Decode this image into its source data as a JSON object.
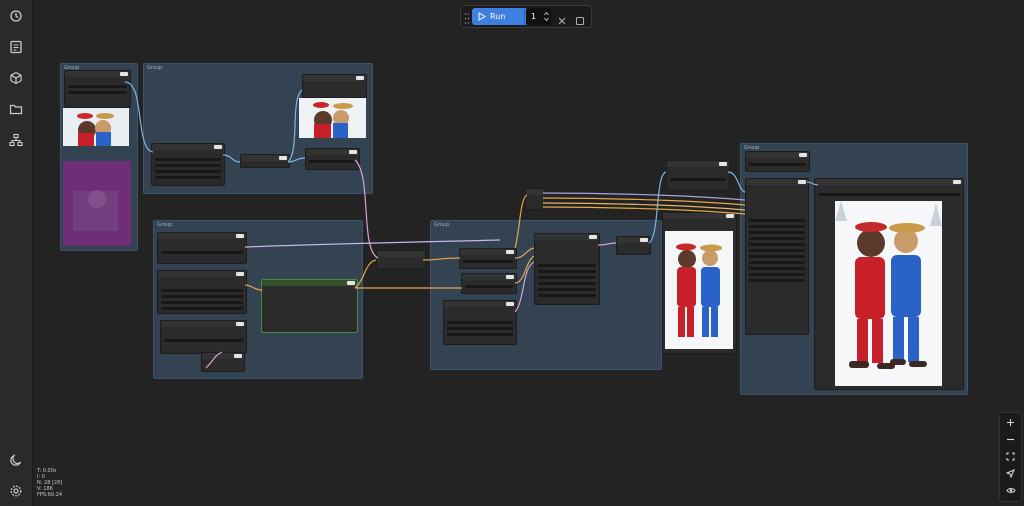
{
  "toolbar": {
    "run_label": "Run",
    "queue_count": "1"
  },
  "groups": {
    "g1": "Group",
    "g2": "Group",
    "g3": "Group",
    "g4": "Group",
    "g5": "Group"
  },
  "stats": {
    "line1": "T: 0.00s",
    "line2": "I: 0",
    "line3": "N: 28 [28]",
    "line4": "V: 186",
    "line5": "FPS:60.24"
  },
  "icons": {
    "history": "history-icon",
    "queue": "queue-icon",
    "nodes": "cube-icon",
    "files": "folder-icon",
    "models": "workflow-icon",
    "theme": "moon-icon",
    "settings": "gear-icon",
    "zoom_in": "plus-icon",
    "zoom_out": "minus-icon",
    "fit": "fit-view-icon",
    "select": "cursor-icon",
    "toggle": "eye-icon"
  },
  "colors": {
    "run_button": "#3f7fe0",
    "group_bg": "#334352",
    "wire_blue": "#7fb4e6",
    "wire_orange": "#e6a64a",
    "wire_pink": "#d9a2d6",
    "node_highlight": "#4a8a3a"
  }
}
